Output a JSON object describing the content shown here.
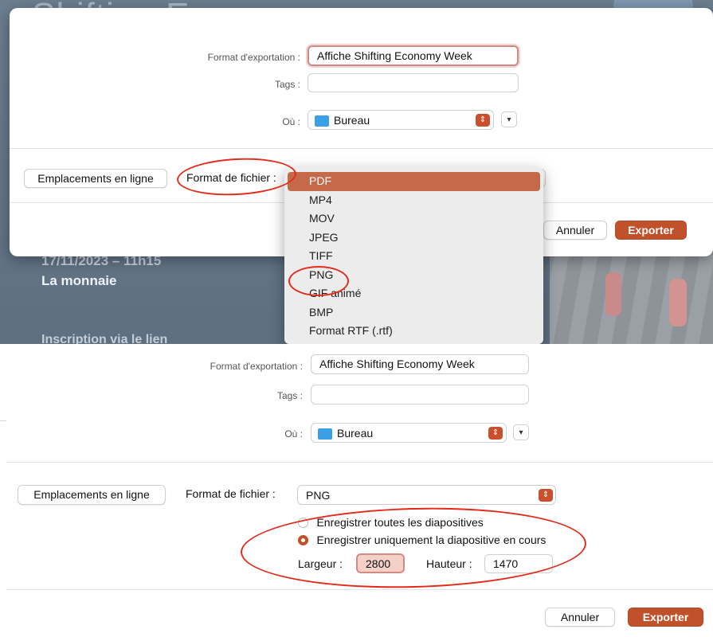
{
  "background": {
    "logo_text": "Shifting Economy",
    "date_text": "17/11/2023 – 11h15",
    "venue_text": "La monnaie",
    "lower_text": "Inscription via le lien"
  },
  "top_dialog": {
    "export_label": "Format d'exportation :",
    "export_value": "Affiche Shifting Economy Week",
    "tags_label": "Tags :",
    "tags_value": "",
    "where_label": "Où :",
    "where_value": "Bureau",
    "online_button": "Emplacements en ligne",
    "file_format_label": "Format de fichier :",
    "cancel_button": "Annuler",
    "export_button": "Exporter",
    "format_menu": {
      "items": [
        "PDF",
        "MP4",
        "MOV",
        "JPEG",
        "TIFF",
        "PNG",
        "GIF animé",
        "BMP",
        "Format RTF (.rtf)"
      ],
      "selected": "PDF"
    }
  },
  "bottom_dialog": {
    "export_label": "Format d'exportation :",
    "export_value": "Affiche Shifting Economy Week",
    "tags_label": "Tags :",
    "tags_value": "",
    "where_label": "Où :",
    "where_value": "Bureau",
    "online_button": "Emplacements en ligne",
    "file_format_label": "Format de fichier :",
    "file_format_value": "PNG",
    "option_all": "Enregistrer toutes les diapositives",
    "option_current": "Enregistrer uniquement la diapositive en cours",
    "width_label": "Largeur :",
    "width_value": "2800",
    "height_label": "Hauteur :",
    "height_value": "1470",
    "cancel_button": "Annuler",
    "export_button": "Exporter"
  },
  "colors": {
    "accent": "#c0512a",
    "annotation_red": "#e32a1a",
    "folder_blue": "#3aa0e6"
  }
}
